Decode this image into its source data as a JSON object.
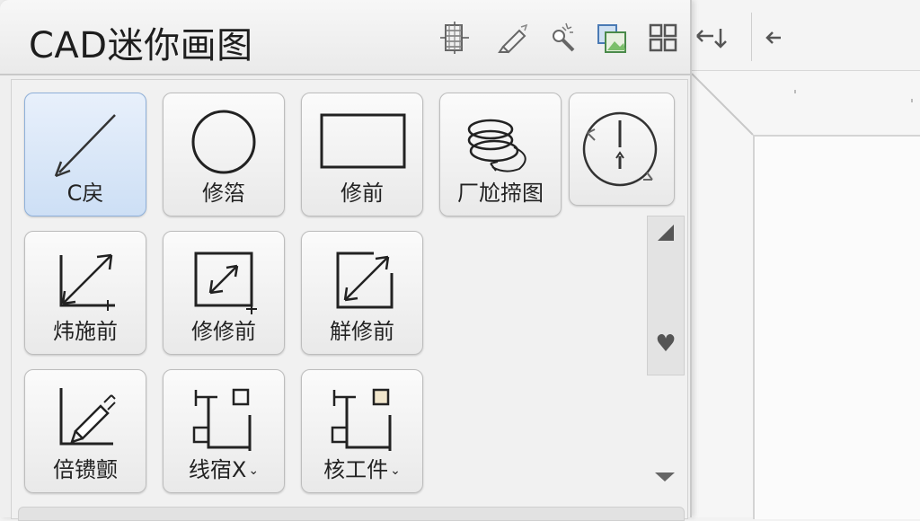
{
  "panel": {
    "title": "CAD迷你画图",
    "toolbar_icons": [
      {
        "name": "hatch-grid-icon"
      },
      {
        "name": "pencil-eraser-icon"
      },
      {
        "name": "magic-wand-icon"
      },
      {
        "name": "layers-image-icon"
      },
      {
        "name": "grid-view-icon"
      },
      {
        "name": "undo-arrow-icon"
      }
    ],
    "extra_icon": {
      "name": "back-arrow-icon"
    }
  },
  "tools": [
    {
      "name": "line",
      "label": "C戻",
      "icon": "line-arrow-icon",
      "active": true
    },
    {
      "name": "circle",
      "label": "修箈",
      "icon": "circle-icon"
    },
    {
      "name": "rectangle",
      "label": "修前",
      "icon": "rectangle-icon"
    },
    {
      "name": "spiral",
      "label": "厂尬揥图",
      "icon": "spiral-coil-icon"
    },
    {
      "name": "rotate",
      "label": "",
      "icon": "rotate-clock-icon"
    },
    {
      "name": "expand",
      "label": "炜施前",
      "icon": "expand-arrow-icon"
    },
    {
      "name": "shrink",
      "label": "修修前",
      "icon": "shrink-box-icon"
    },
    {
      "name": "extend",
      "label": "觧修前",
      "icon": "extend-arrow-icon"
    },
    {
      "name": "draw-axis",
      "label": "倍镄颤",
      "icon": "pen-axis-icon"
    },
    {
      "name": "align-a",
      "label": "线宿X",
      "icon": "align-frame-icon",
      "dropdown": true
    },
    {
      "name": "align-b",
      "label": "核工件",
      "icon": "align-frame-icon",
      "dropdown": true
    }
  ],
  "scroll": {
    "up": "▲",
    "down": "▼",
    "heart": "♥"
  }
}
